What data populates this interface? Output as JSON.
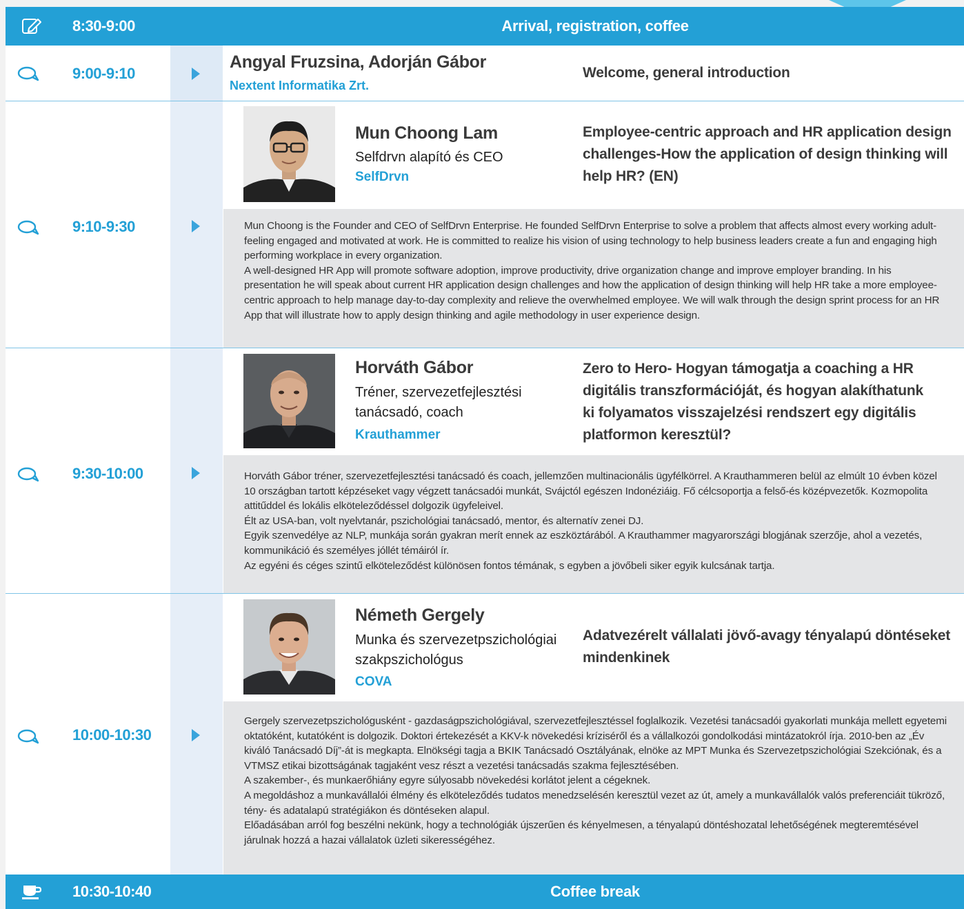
{
  "colors": {
    "accent": "#23a0d6",
    "bar_text": "#ffffff",
    "bio_bg": "#e4e5e7",
    "arrow_col": "#e6eef8"
  },
  "registration": {
    "icon": "edit-icon",
    "time": "8:30-9:00",
    "title": "Arrival, registration, coffee"
  },
  "welcome": {
    "icon": "chat-icon",
    "time": "9:00-9:10",
    "speakers": "Angyal Fruzsina, Adorján Gábor",
    "org": "Nextent Informatika Zrt.",
    "talk": "Welcome, general introduction"
  },
  "session1": {
    "time": "9:10-9:30",
    "name": "Mun Choong Lam",
    "role": "Selfdrvn alapító és CEO",
    "org": "SelfDrvn",
    "talk": "Employee-centric approach and HR application design challenges-How the application of design thinking will help HR? (EN)",
    "bio": [
      "Mun Choong is the Founder and CEO of SelfDrvn Enterprise. He founded SelfDrvn Enterprise to solve a problem that affects almost every working adult- feeling engaged and motivated at work. He is committed to realize his vision of using technology to help business leaders create a fun and engaging high performing workplace in every organization.",
      "A well-designed HR App will promote software adoption, improve productivity, drive organization change and improve employer branding.  In his presentation he will speak about current HR application design challenges and how the application of design thinking will help HR take a more employee-centric approach to help manage day-to-day complexity and relieve the overwhelmed employee.  We will walk through the design sprint process for an HR App that will illustrate how to apply design thinking and agile methodology in user experience design."
    ]
  },
  "session2": {
    "time": "9:30-10:00",
    "name": "Horváth Gábor",
    "role": "Tréner, szervezetfejlesztési tanácsadó, coach",
    "org": "Krauthammer",
    "talk": "Zero to Hero- Hogyan támogatja a coaching a HR digitális transzformációját, és hogyan alakíthatunk ki folyamatos visszajelzési rendszert egy digitális platformon keresztül?",
    "bio": [
      "Horváth Gábor tréner, szervezetfejlesztési tanácsadó és coach, jellemzően multinacionális ügyfélkörrel. A Krauthammeren belül az elmúlt 10 évben közel 10 országban tartott képzéseket vagy végzett tanácsadói munkát, Svájctól egészen Indonéziáig. Fő célcsoportja a felső-és középvezetők. Kozmopolita attitűddel és lokális elköteleződéssel dolgozik ügyfeleivel.",
      "Élt az USA-ban, volt nyelvtanár, pszichológiai tanácsadó, mentor, és alternatív zenei DJ.",
      "Egyik szenvedélye az NLP, munkája során gyakran merít ennek az eszköztárából. A Krauthammer magyarországi blogjának szerzője, ahol a vezetés, kommunikáció és személyes jóllét témáiról ír.",
      "Az egyéni és céges szintű elköteleződést különösen fontos témának, s egyben a jövőbeli siker egyik kulcsának tartja."
    ]
  },
  "session3": {
    "time": "10:00-10:30",
    "name": "Németh Gergely",
    "role": "Munka és szervezetpszichológiai szakpszichológus",
    "org": "COVA",
    "talk": "Adatvezérelt vállalati jövő-avagy tényalapú döntéseket mindenkinek",
    "bio": [
      "Gergely szervezetpszichológusként - gazdaságpszichológiával, szervezetfejlesztéssel foglalkozik. Vezetési tanácsadói gyakorlati munkája mellett egyetemi oktatóként, kutatóként is dolgozik. Doktori értekezését a KKV-k növekedési kríziséről és a vállalkozói gondolkodási mintázatokról írja. 2010-ben az „Év kiváló Tanácsadó Díj”-át is megkapta. Elnökségi tagja a BKIK Tanácsadó Osztályának, elnöke az MPT Munka és Szervezetpszichológiai Szekciónak, és a VTMSZ etikai bizottságának tagjaként vesz részt a vezetési tanácsadás szakma fejlesztésében.",
      "A szakember-, és munkaerőhiány egyre súlyosabb növekedési korlátot jelent a cégeknek.",
      "A megoldáshoz a munkavállalói élmény és elköteleződés tudatos menedzselésén keresztül vezet az út, amely a munkavállalók valós preferenciáit tükröző, tény- és adatalapú stratégiákon és döntéseken alapul.",
      "Előadásában arról fog beszélni nekünk, hogy a technológiák újszerűen és kényelmesen, a tényalapú döntéshozatal lehetőségének megteremtésével járulnak hozzá a hazai vállalatok üzleti sikerességéhez."
    ]
  },
  "coffee": {
    "icon": "coffee-cup-icon",
    "time": "10:30-10:40",
    "title": "Coffee break"
  }
}
